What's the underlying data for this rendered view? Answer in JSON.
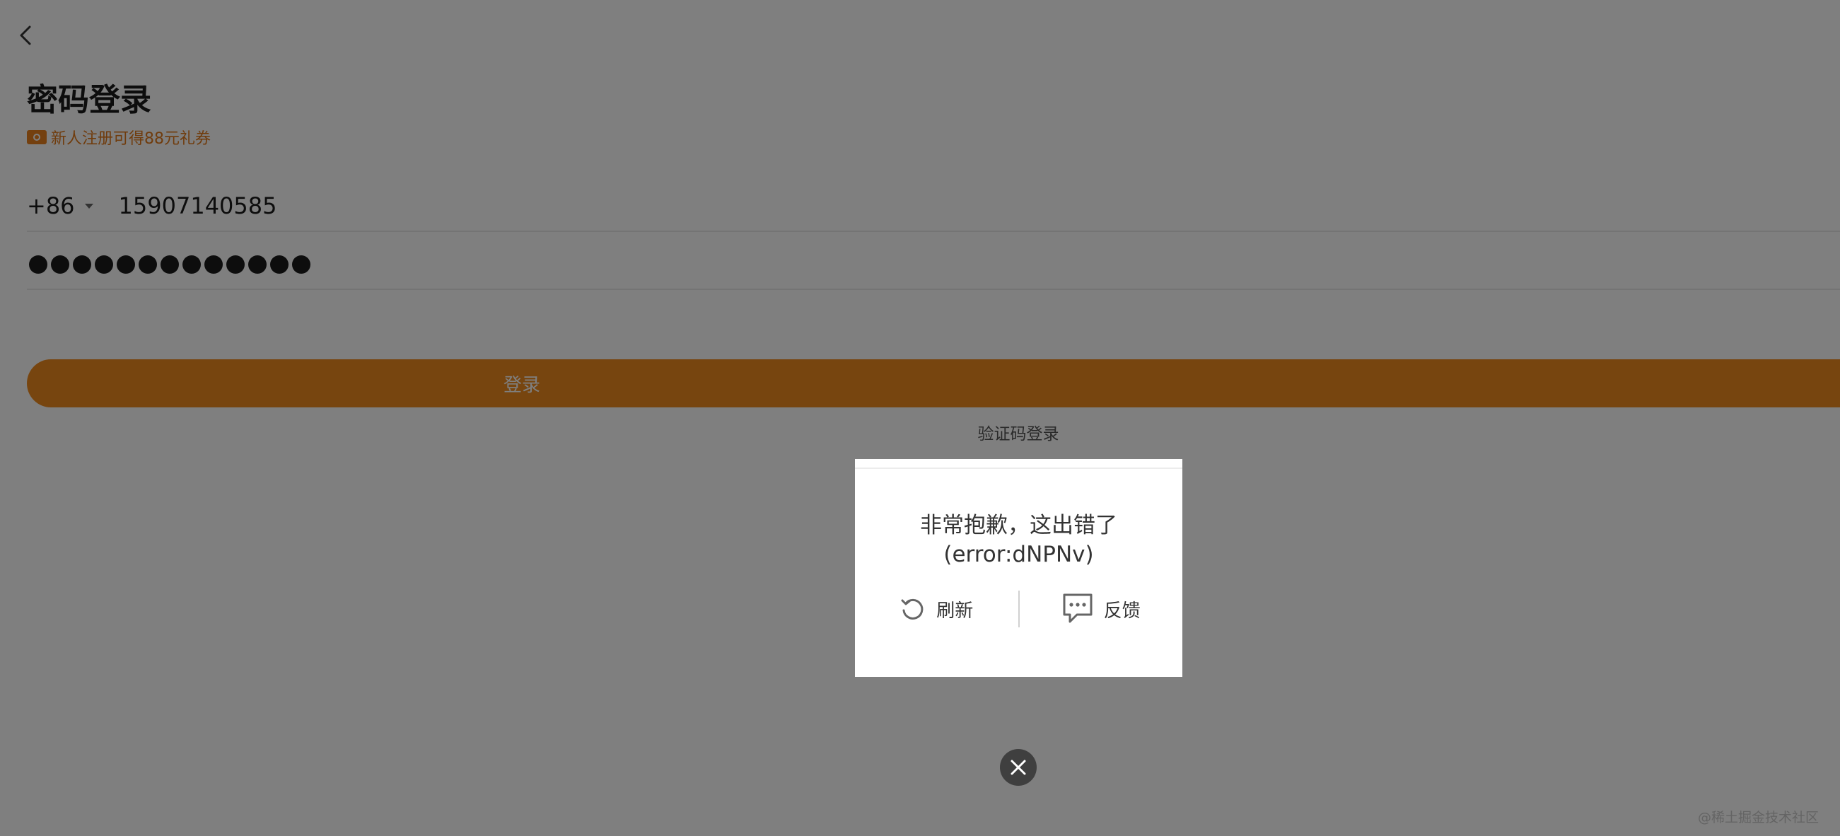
{
  "page": {
    "title": "密码登录",
    "promo_text": "新人注册可得88元礼券",
    "brand_color": "#ef8a1f"
  },
  "form": {
    "country_code": "+86",
    "phone_value": "15907140585",
    "password_mask_length": 13,
    "login_button_label": "登录",
    "alt_login_label": "验证码登录"
  },
  "dialog": {
    "message_line1": "非常抱歉，这出错了",
    "message_line2": "(error:dNPNv)",
    "refresh_label": "刷新",
    "feedback_label": "反馈"
  },
  "watermark": "@稀土掘金技术社区",
  "icons": {
    "back": "chevron-left-icon",
    "promo": "coupon-icon",
    "caret": "caret-down-icon",
    "refresh": "refresh-icon",
    "feedback": "chat-bubble-icon",
    "close": "close-icon"
  }
}
